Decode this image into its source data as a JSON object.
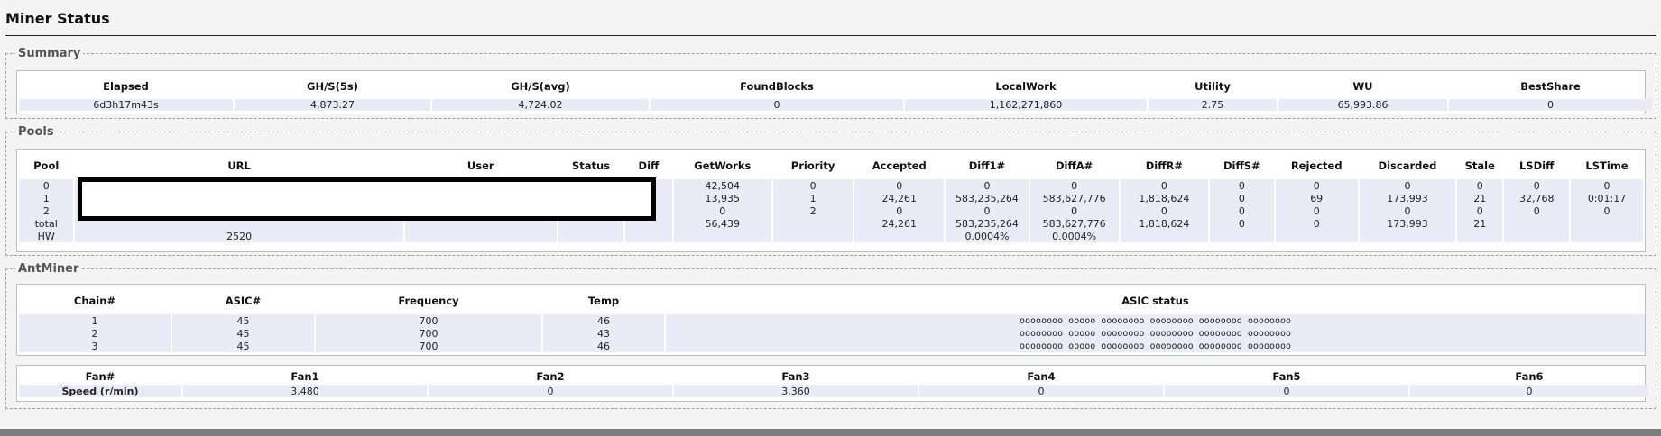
{
  "page": {
    "title": "Miner Status"
  },
  "summary": {
    "legend": "Summary",
    "headers": [
      "Elapsed",
      "GH/S(5s)",
      "GH/S(avg)",
      "FoundBlocks",
      "LocalWork",
      "Utility",
      "WU",
      "BestShare"
    ],
    "row": [
      "6d3h17m43s",
      "4,873.27",
      "4,724.02",
      "0",
      "1,162,271,860",
      "2.75",
      "65,993.86",
      "0"
    ]
  },
  "pools": {
    "legend": "Pools",
    "headers": [
      "Pool",
      "URL",
      "User",
      "Status",
      "Diff",
      "GetWorks",
      "Priority",
      "Accepted",
      "Diff1#",
      "DiffA#",
      "DiffR#",
      "DiffS#",
      "Rejected",
      "Discarded",
      "Stale",
      "LSDiff",
      "LSTime"
    ],
    "rows": [
      [
        "0",
        "",
        "",
        "",
        "",
        "42,504",
        "0",
        "0",
        "0",
        "0",
        "0",
        "0",
        "0",
        "0",
        "0",
        "0",
        "0"
      ],
      [
        "1",
        "",
        "",
        "",
        "",
        "13,935",
        "1",
        "24,261",
        "583,235,264",
        "583,627,776",
        "1,818,624",
        "0",
        "69",
        "173,993",
        "21",
        "32,768",
        "0:01:17"
      ],
      [
        "2",
        "",
        "",
        "",
        "",
        "0",
        "2",
        "0",
        "0",
        "0",
        "0",
        "0",
        "0",
        "0",
        "0",
        "0",
        "0"
      ],
      [
        "total",
        "",
        "",
        "",
        "",
        "56,439",
        "",
        "24,261",
        "583,235,264",
        "583,627,776",
        "1,818,624",
        "0",
        "0",
        "173,993",
        "21",
        "",
        ""
      ],
      [
        "HW",
        "2520",
        "",
        "",
        "",
        "",
        "",
        "",
        "0.0004%",
        "0.0004%",
        "",
        "",
        "",
        "",
        "",
        "",
        ""
      ]
    ]
  },
  "antminer": {
    "legend": "AntMiner",
    "chain_headers": [
      "Chain#",
      "ASIC#",
      "Frequency",
      "Temp",
      "ASIC status"
    ],
    "chains": [
      [
        "1",
        "45",
        "700",
        "46",
        "oooooooo ooooo oooooooo oooooooo oooooooo oooooooo"
      ],
      [
        "2",
        "45",
        "700",
        "43",
        "oooooooo ooooo oooooooo oooooooo oooooooo oooooooo"
      ],
      [
        "3",
        "45",
        "700",
        "46",
        "oooooooo ooooo oooooooo oooooooo oooooooo oooooooo"
      ]
    ],
    "fan_headers": [
      "Fan#",
      "Fan1",
      "Fan2",
      "Fan3",
      "Fan4",
      "Fan5",
      "Fan6"
    ],
    "fan_row": [
      "Speed (r/min)",
      "3,480",
      "0",
      "3,360",
      "0",
      "0",
      "0"
    ]
  }
}
